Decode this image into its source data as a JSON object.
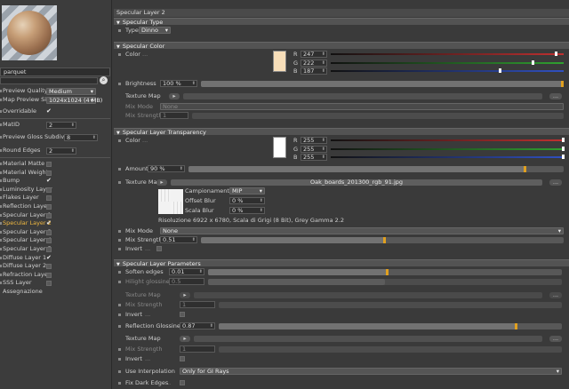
{
  "left": {
    "material_name": "parquet",
    "rows": [
      {
        "label": "Preview Quality",
        "value": "Medium"
      },
      {
        "label": "Map Preview Size",
        "value": "1024x1024 (4 MB)"
      },
      {
        "label": "Overridable"
      },
      {
        "label": "MatID",
        "value": "2"
      },
      {
        "label": "Preview Gloss Subdivs",
        "value": "8"
      },
      {
        "label": "Round Edges",
        "value": "2"
      }
    ],
    "layers": [
      {
        "label": "Material Matte",
        "checked": false,
        "active": false
      },
      {
        "label": "Material Weight",
        "checked": false,
        "active": false
      },
      {
        "label": "Bump",
        "checked": true,
        "active": false
      },
      {
        "label": "Luminosity Layer",
        "checked": false,
        "active": false
      },
      {
        "label": "Flakes Layer",
        "checked": false,
        "active": false
      },
      {
        "label": "Reflection Layer",
        "checked": false,
        "active": false
      },
      {
        "label": "Specular Layer 1",
        "checked": false,
        "active": false
      },
      {
        "label": "Specular Layer 2",
        "checked": true,
        "active": true
      },
      {
        "label": "Specular Layer 3",
        "checked": false,
        "active": false
      },
      {
        "label": "Specular Layer 4",
        "checked": false,
        "active": false
      },
      {
        "label": "Specular Layer 5",
        "checked": false,
        "active": false
      },
      {
        "label": "Diffuse Layer 1",
        "checked": true,
        "active": false
      },
      {
        "label": "Diffuse Layer 2",
        "checked": false,
        "active": false
      },
      {
        "label": "Refraction Layer",
        "checked": false,
        "active": false
      },
      {
        "label": "SSS Layer",
        "checked": false,
        "active": false
      },
      {
        "label": "Assegnazione",
        "checked": false,
        "active": false
      }
    ]
  },
  "title": "Specular Layer 2",
  "sections": {
    "type": "Specular Type",
    "color": "Specular Color",
    "transparency": "Specular Layer Transparency",
    "params": "Specular Layer Parameters"
  },
  "type_row": {
    "label": "Type",
    "value": "Dinno"
  },
  "spec_color": {
    "label": "Color",
    "swatch": "#f7deb9",
    "channels": [
      {
        "ch": "R",
        "value": "247",
        "color": "#c03030",
        "level": 0.97
      },
      {
        "ch": "G",
        "value": "222",
        "color": "#30a030",
        "level": 0.87
      },
      {
        "ch": "B",
        "value": "187",
        "color": "#3050c0",
        "level": 0.73
      }
    ],
    "brightness_label": "Brightness",
    "brightness": "100 %",
    "brightness_level": 1.0,
    "texture_map": "Texture Map",
    "mix_mode_label": "Mix Mode",
    "mix_mode": "None",
    "mix_strength_label": "Mix Strength",
    "mix_strength": "1",
    "dots": "..."
  },
  "transp": {
    "label": "Color",
    "swatch": "#ffffff",
    "channels": [
      {
        "ch": "R",
        "value": "255",
        "color": "#c03030",
        "level": 1.0
      },
      {
        "ch": "G",
        "value": "255",
        "color": "#30a030",
        "level": 1.0
      },
      {
        "ch": "B",
        "value": "255",
        "color": "#3050c0",
        "level": 1.0
      }
    ],
    "amount_label": "Amount",
    "amount": "90 %",
    "amount_level": 0.9,
    "texture_map": "Texture Map",
    "file": "Oak_boards_201300_rgb_91.jpg",
    "sampling_label": "Campionamento",
    "sampling": "MIP",
    "offset_label": "Offset Blur",
    "offset": "0 %",
    "scale_label": "Scala Blur",
    "scale": "0 %",
    "info": "Risoluzione 6922 x 6780, Scala di Grigi (8 Bit), Grey Gamma 2.2",
    "mix_mode_label": "Mix Mode",
    "mix_mode": "None",
    "mix_strength_label": "Mix Strength",
    "mix_strength": "0.51",
    "mix_strength_level": 0.51,
    "invert_label": "Invert",
    "dots": "..."
  },
  "params": {
    "soften_label": "Soften edges",
    "soften": "0.01",
    "soften_level": 0.51,
    "hilight_label": "Hilight glossiness",
    "hilight": "0.5",
    "hilight_level": 0.5,
    "tex1_label": "Texture Map",
    "ms1_label": "Mix Strength",
    "ms1": "1",
    "inv1_label": "Invert",
    "refl_label": "Reflection Glossiness",
    "refl": "0.87",
    "refl_level": 0.87,
    "tex2_label": "Texture Map",
    "ms2_label": "Mix Strength",
    "ms2": "1",
    "inv2_label": "Invert",
    "interp_label": "Use Interpolation",
    "interp": "Only for GI Rays",
    "fix_label": "Fix Dark Edges",
    "dots": "..."
  }
}
